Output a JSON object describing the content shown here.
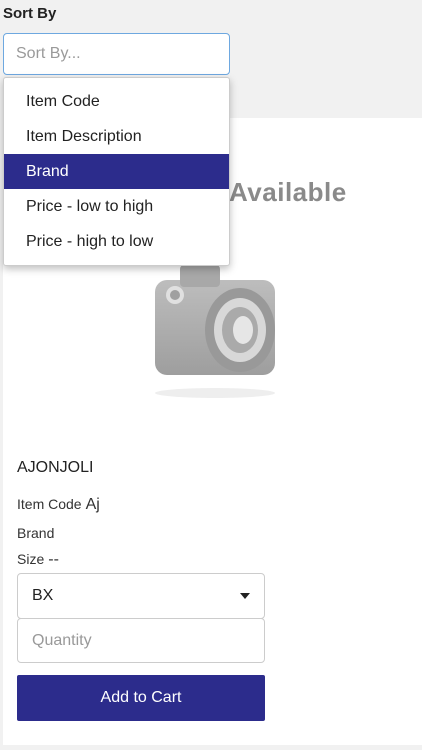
{
  "sort": {
    "label": "Sort By",
    "placeholder": "Sort By...",
    "options": [
      {
        "label": "Item Code",
        "selected": false
      },
      {
        "label": "Item Description",
        "selected": false
      },
      {
        "label": "Brand",
        "selected": true
      },
      {
        "label": "Price - low to high",
        "selected": false
      },
      {
        "label": "Price - high to low",
        "selected": false
      }
    ]
  },
  "product": {
    "image_text": "Available",
    "name": "AJONJOLI",
    "item_code_label": "Item Code",
    "item_code_value": "Aj",
    "brand_label": "Brand",
    "size_label": "Size",
    "size_value": "--",
    "unit_selected": "BX",
    "quantity_placeholder": "Quantity",
    "add_to_cart_label": "Add to Cart"
  },
  "colors": {
    "accent": "#2c2c8c",
    "focus_border": "#6ea8e0"
  }
}
